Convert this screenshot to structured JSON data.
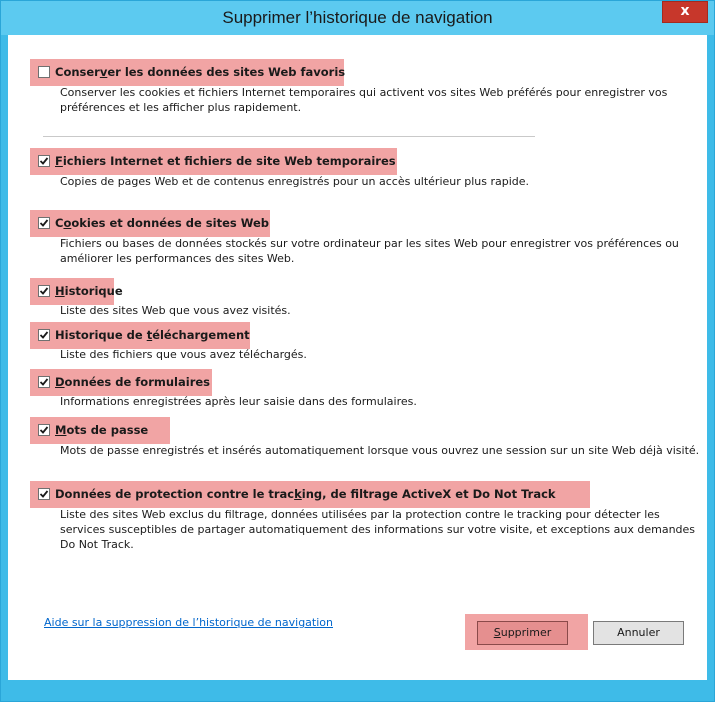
{
  "window": {
    "title": "Supprimer l’historique de navigation",
    "close_glyph": "x"
  },
  "options": [
    {
      "id": "favorites",
      "checked": false,
      "label_before": "Conser",
      "label_accel": "v",
      "label_after": "er les données des sites Web favoris",
      "description": "Conserver les cookies et fichiers Internet temporaires qui activent vos sites Web préférés pour enregistrer vos préférences et les afficher plus rapidement."
    },
    {
      "id": "temp-files",
      "checked": true,
      "label_before": "",
      "label_accel": "F",
      "label_after": "ichiers Internet et fichiers de site Web temporaires",
      "description": "Copies de pages Web et de contenus enregistrés pour un accès ultérieur plus rapide."
    },
    {
      "id": "cookies",
      "checked": true,
      "label_before": "C",
      "label_accel": "o",
      "label_after": "okies et données de sites Web",
      "description": "Fichiers ou bases de données stockés sur votre ordinateur par les sites Web pour enregistrer vos préférences ou améliorer les performances des sites Web."
    },
    {
      "id": "history",
      "checked": true,
      "label_before": "",
      "label_accel": "H",
      "label_after": "istorique",
      "description": "Liste des sites Web que vous avez visités."
    },
    {
      "id": "download-history",
      "checked": true,
      "label_before": "Historique de ",
      "label_accel": "t",
      "label_after": "éléchargement",
      "description": "Liste des fichiers que vous avez téléchargés."
    },
    {
      "id": "form-data",
      "checked": true,
      "label_before": "",
      "label_accel": "D",
      "label_after": "onnées de formulaires",
      "description": "Informations enregistrées après leur saisie dans des formulaires."
    },
    {
      "id": "passwords",
      "checked": true,
      "label_before": "",
      "label_accel": "M",
      "label_after": "ots de passe",
      "description": "Mots de passe enregistrés et insérés automatiquement lorsque vous ouvrez une session sur un site Web déjà visité."
    },
    {
      "id": "tracking",
      "checked": true,
      "label_before": "Données de protection contre le trac",
      "label_accel": "k",
      "label_after": "ing, de filtrage ActiveX et Do Not Track",
      "description": "Liste des sites Web exclus du filtrage, données utilisées par la protection contre le tracking pour détecter les services susceptibles de partager automatiquement des informations sur votre visite, et exceptions aux demandes Do Not Track."
    }
  ],
  "footer": {
    "help_link": "Aide sur la suppression de l’historique de navigation",
    "delete_accel": "S",
    "delete_rest": "upprimer",
    "cancel_label": "Annuler"
  },
  "colors": {
    "title_bar": "#5ccaf0",
    "frame": "#3ebbe8",
    "highlight": "#f1a4a4",
    "close_button": "#c7372b",
    "link": "#0066cc"
  }
}
